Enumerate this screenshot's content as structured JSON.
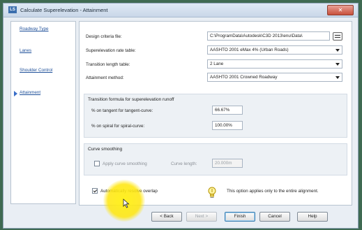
{
  "window": {
    "app_icon": "LS",
    "title": "Calculate Superelevation - Attainment",
    "close_glyph": "✕"
  },
  "nav": {
    "items": [
      "Roadway Type",
      "Lanes",
      "Shoulder Control",
      "Attainment"
    ],
    "selected": "Attainment"
  },
  "form": {
    "design_criteria_label": "Design criteria file:",
    "design_criteria_value": "C:\\ProgramData\\Autodesk\\C3D 2013\\enu\\Data\\",
    "rate_table_label": "Superelevation rate table:",
    "rate_table_value": "AASHTO 2001 eMax 4% (Urban Roads)",
    "length_table_label": "Transition length table:",
    "length_table_value": "2 Lane",
    "method_label": "Attainment method:",
    "method_value": "AASHTO 2001 Crowned Roadway"
  },
  "runoff": {
    "title": "Transition formula for superelevation runoff",
    "tangent_label": "% on tangent for tangent-curve:",
    "tangent_value": "66.67%",
    "spiral_label": "% on spiral for spiral-curve:",
    "spiral_value": "100.00%"
  },
  "smoothing": {
    "title": "Curve smoothing",
    "apply_label": "Apply curve smoothing",
    "curve_length_label": "Curve length:",
    "curve_length_value": "20.000m"
  },
  "overlap": {
    "label": "Automatically resolve overlap",
    "checked": true,
    "hint": "This option applies only to the entire alignment."
  },
  "buttons": {
    "back": "< Back",
    "next": "Next >",
    "finish": "Finish",
    "cancel": "Cancel",
    "help": "Help"
  },
  "icons": {
    "browse": "browse-icon",
    "hint": "lightbulb-icon",
    "cursor": "mouse-pointer-icon"
  },
  "colors": {
    "nav_link": "#1d4f99",
    "highlight": "#ffe81a",
    "close": "#c8503c"
  }
}
